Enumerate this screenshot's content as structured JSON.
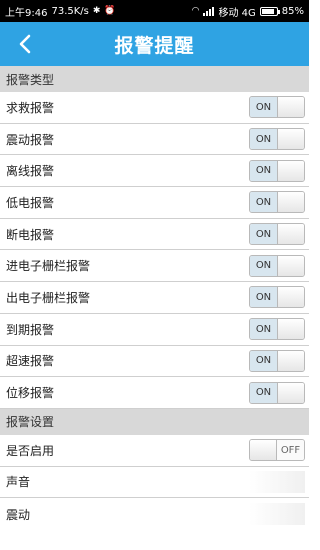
{
  "status_bar": {
    "time": "上午9:46",
    "speed": "73.5K/s",
    "carrier": "移动 4G",
    "battery": "85%",
    "battery_level": 0.85,
    "icons": [
      "bluetooth-icon",
      "alarm-icon",
      "wifi-icon",
      "signal-icon",
      "battery-icon"
    ]
  },
  "header": {
    "title": "报警提醒",
    "back_icon": "chevron-left-icon",
    "color": "#2fa3e3"
  },
  "alarm_types": {
    "title": "报警类型",
    "items": [
      {
        "label": "求救报警",
        "state": "ON"
      },
      {
        "label": "震动报警",
        "state": "ON"
      },
      {
        "label": "离线报警",
        "state": "ON"
      },
      {
        "label": "低电报警",
        "state": "ON"
      },
      {
        "label": "断电报警",
        "state": "ON"
      },
      {
        "label": "进电子栅栏报警",
        "state": "ON"
      },
      {
        "label": "出电子栅栏报警",
        "state": "ON"
      },
      {
        "label": "到期报警",
        "state": "ON"
      },
      {
        "label": "超速报警",
        "state": "ON"
      },
      {
        "label": "位移报警",
        "state": "ON"
      }
    ]
  },
  "alarm_settings": {
    "title": "报警设置",
    "enable": {
      "label": "是否启用",
      "state": "OFF"
    },
    "sound": {
      "label": "声音"
    },
    "vibrate": {
      "label": "震动"
    }
  }
}
